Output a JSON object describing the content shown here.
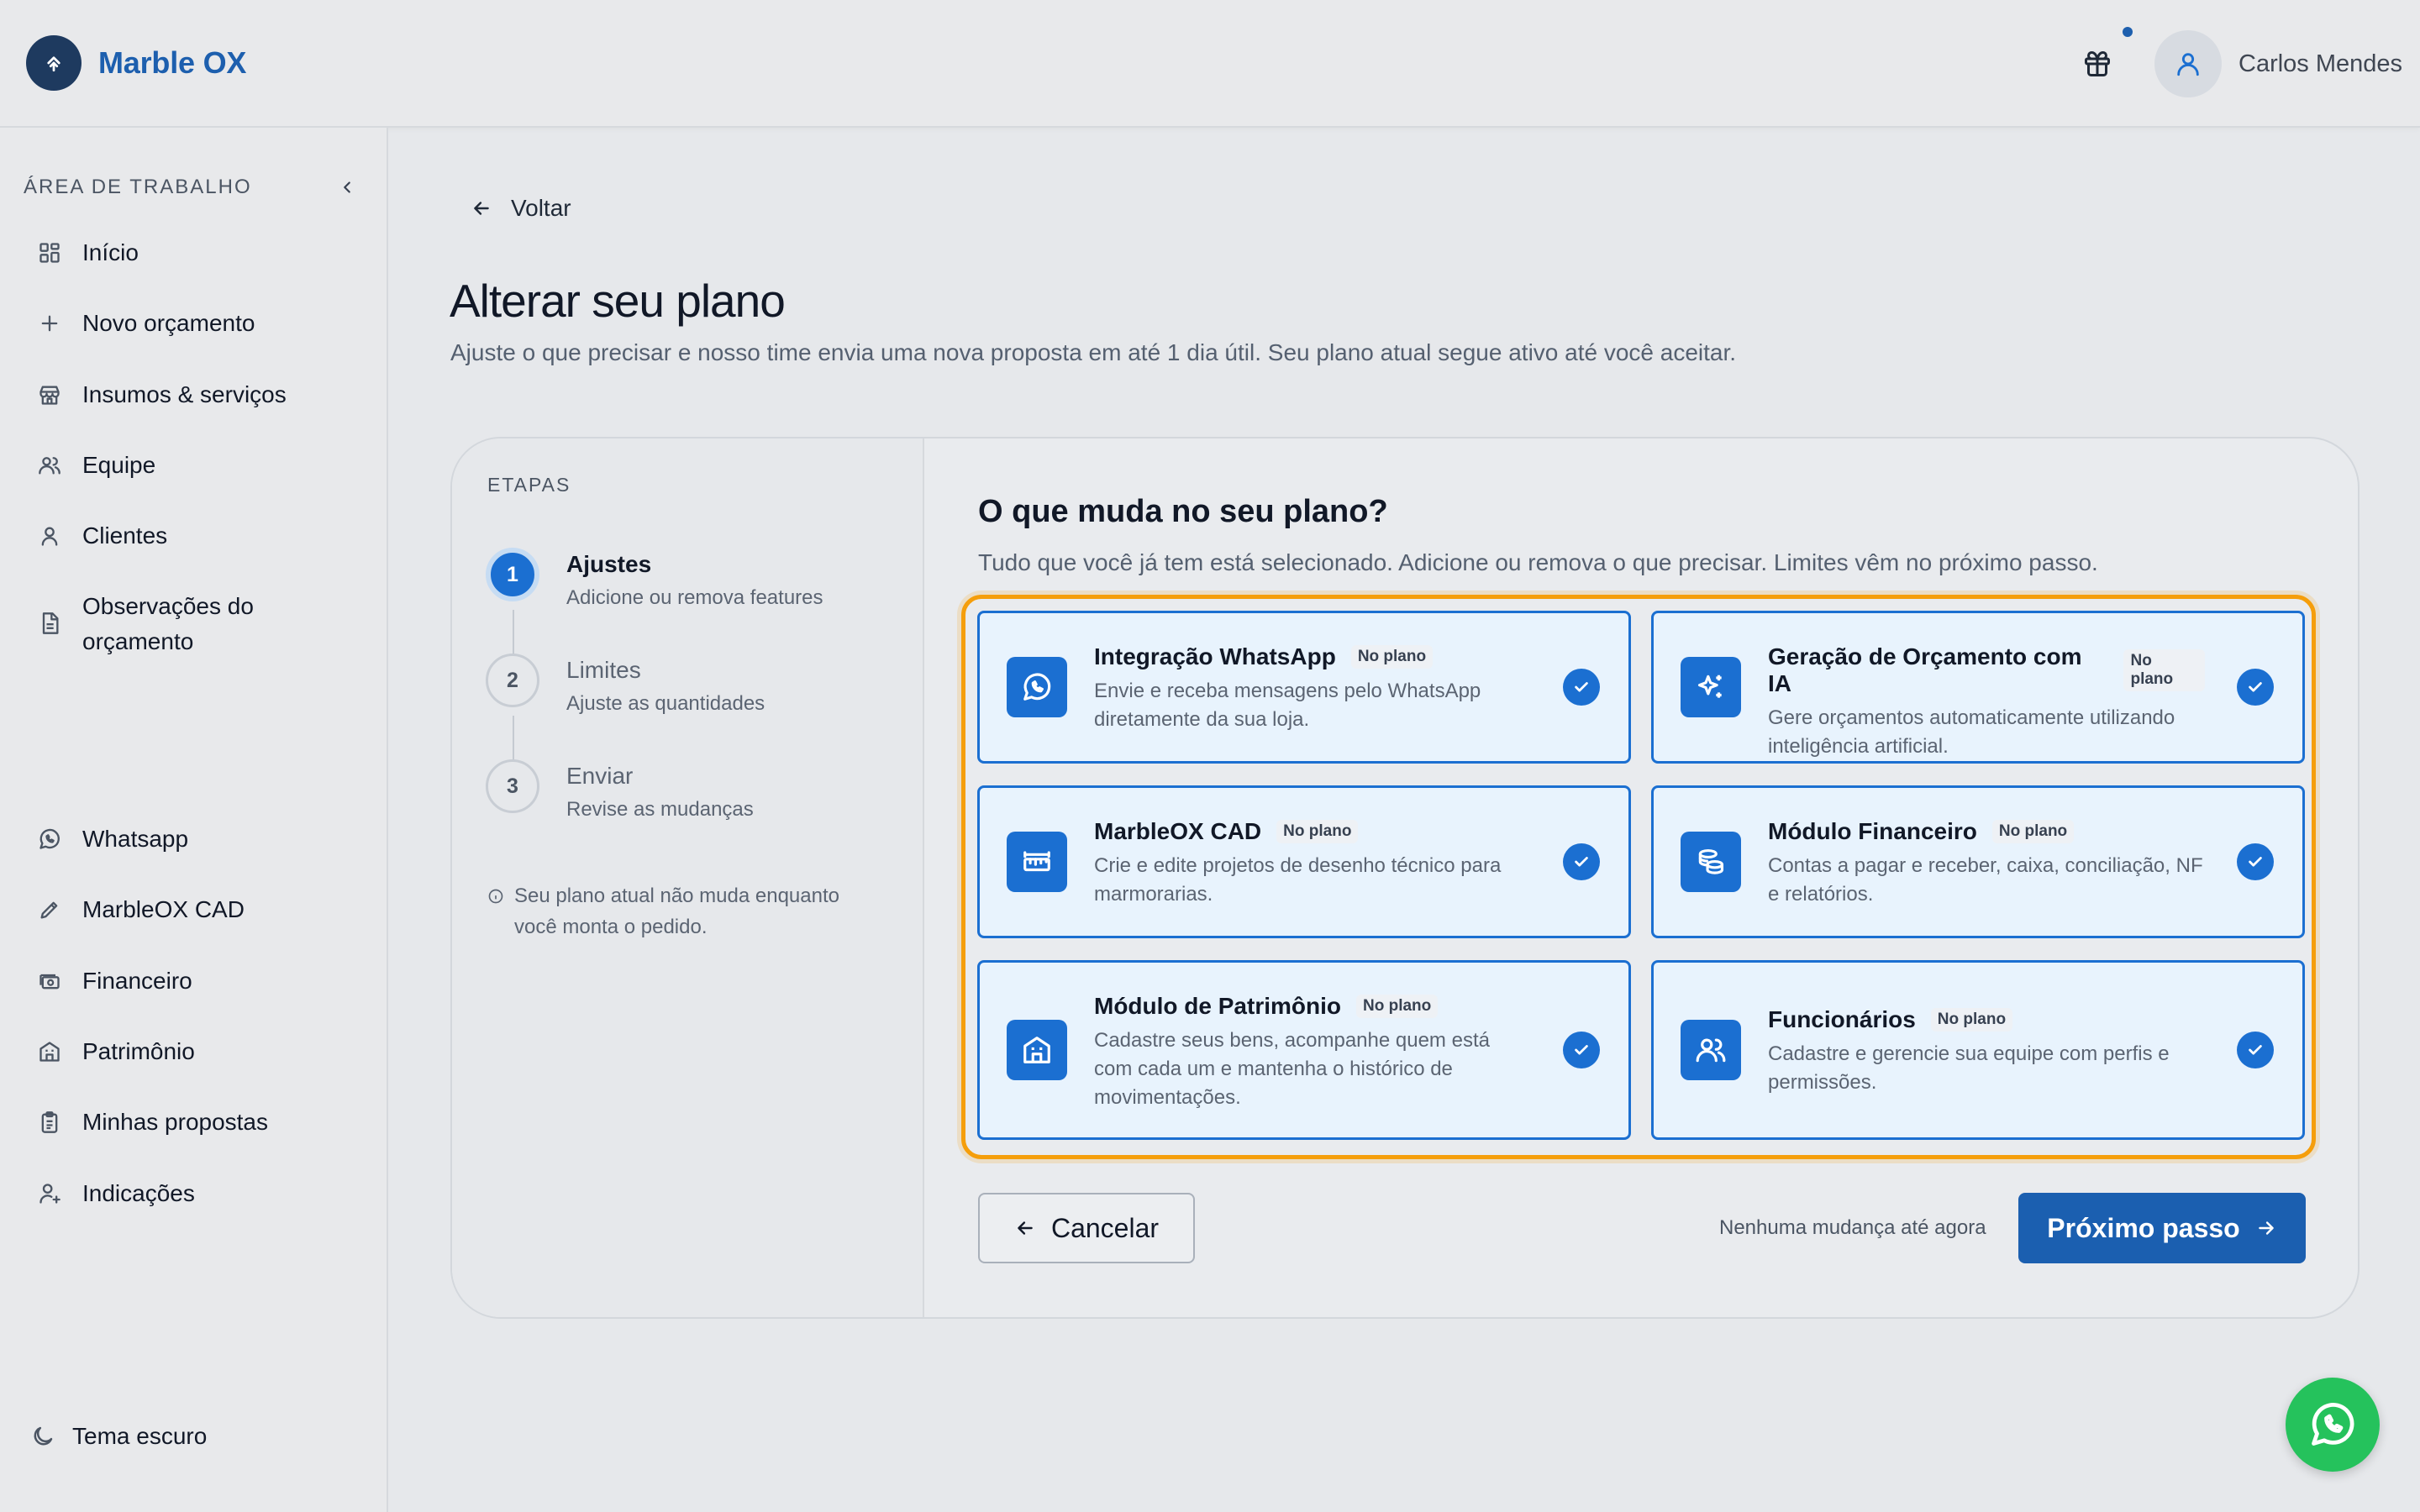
{
  "app": {
    "name": "Marble OX"
  },
  "user": {
    "name": "Carlos Mendes"
  },
  "sidebar": {
    "title": "ÁREA DE TRABALHO",
    "items": [
      {
        "label": "Início",
        "icon": "grid-icon"
      },
      {
        "label": "Novo orçamento",
        "icon": "plus-icon"
      },
      {
        "label": "Insumos & serviços",
        "icon": "store-icon"
      },
      {
        "label": "Equipe",
        "icon": "users-icon"
      },
      {
        "label": "Clientes",
        "icon": "user-icon"
      },
      {
        "label": "Observações do orçamento",
        "icon": "document-icon"
      },
      {
        "label": "Whatsapp",
        "icon": "whatsapp-icon"
      },
      {
        "label": "MarbleOX CAD",
        "icon": "ruler-pencil-icon"
      },
      {
        "label": "Financeiro",
        "icon": "money-icon"
      },
      {
        "label": "Patrimônio",
        "icon": "building-icon"
      },
      {
        "label": "Minhas propostas",
        "icon": "clipboard-icon"
      },
      {
        "label": "Indicações",
        "icon": "user-referral-icon"
      }
    ],
    "theme_toggle": "Tema escuro"
  },
  "page": {
    "back_label": "Voltar",
    "title": "Alterar seu plano",
    "subtitle": "Ajuste o que precisar e nosso time envia uma nova proposta em até 1 dia útil. Seu plano atual segue ativo até você aceitar."
  },
  "steps": {
    "title": "ETAPAS",
    "items": [
      {
        "number": "1",
        "name": "Ajustes",
        "desc": "Adicione ou remova features",
        "active": true
      },
      {
        "number": "2",
        "name": "Limites",
        "desc": "Ajuste as quantidades",
        "active": false
      },
      {
        "number": "3",
        "name": "Enviar",
        "desc": "Revise as mudanças",
        "active": false
      }
    ],
    "note": "Seu plano atual não muda enquanto você monta o pedido."
  },
  "features": {
    "title": "O que muda no seu plano?",
    "subtitle": "Tudo que você já tem está selecionado. Adicione ou remova o que precisar. Limites vêm no próximo passo.",
    "cards": [
      {
        "name": "Integração WhatsApp",
        "badge": "No plano",
        "desc": "Envie e receba mensagens pelo WhatsApp diretamente da sua loja.",
        "icon": "whatsapp-icon",
        "selected": true
      },
      {
        "name": "Geração de Orçamento com IA",
        "badge": "No plano",
        "desc": "Gere orçamentos automaticamente utilizando inteligência artificial.",
        "icon": "sparkles-icon",
        "selected": true
      },
      {
        "name": "MarbleOX CAD",
        "badge": "No plano",
        "desc": "Crie e edite projetos de desenho técnico para marmorarias.",
        "icon": "ruler-icon",
        "selected": true
      },
      {
        "name": "Módulo Financeiro",
        "badge": "No plano",
        "desc": "Contas a pagar e receber, caixa, conciliação, NF e relatórios.",
        "icon": "coins-icon",
        "selected": true
      },
      {
        "name": "Módulo de Patrimônio",
        "badge": "No plano",
        "desc": "Cadastre seus bens, acompanhe quem está com cada um e mantenha o histórico de movimentações.",
        "icon": "building-icon",
        "selected": true
      },
      {
        "name": "Funcionários",
        "badge": "No plano",
        "desc": "Cadastre e gerencie sua equipe com perfis e permissões.",
        "icon": "users-icon",
        "selected": true
      }
    ]
  },
  "footer": {
    "cancel_label": "Cancelar",
    "status": "Nenhuma mudança até agora",
    "next_label": "Próximo passo"
  },
  "colors": {
    "primary": "#1b6fd1",
    "brand": "#1d5fae",
    "highlight": "#f59e0b",
    "whatsapp": "#25c25c"
  }
}
